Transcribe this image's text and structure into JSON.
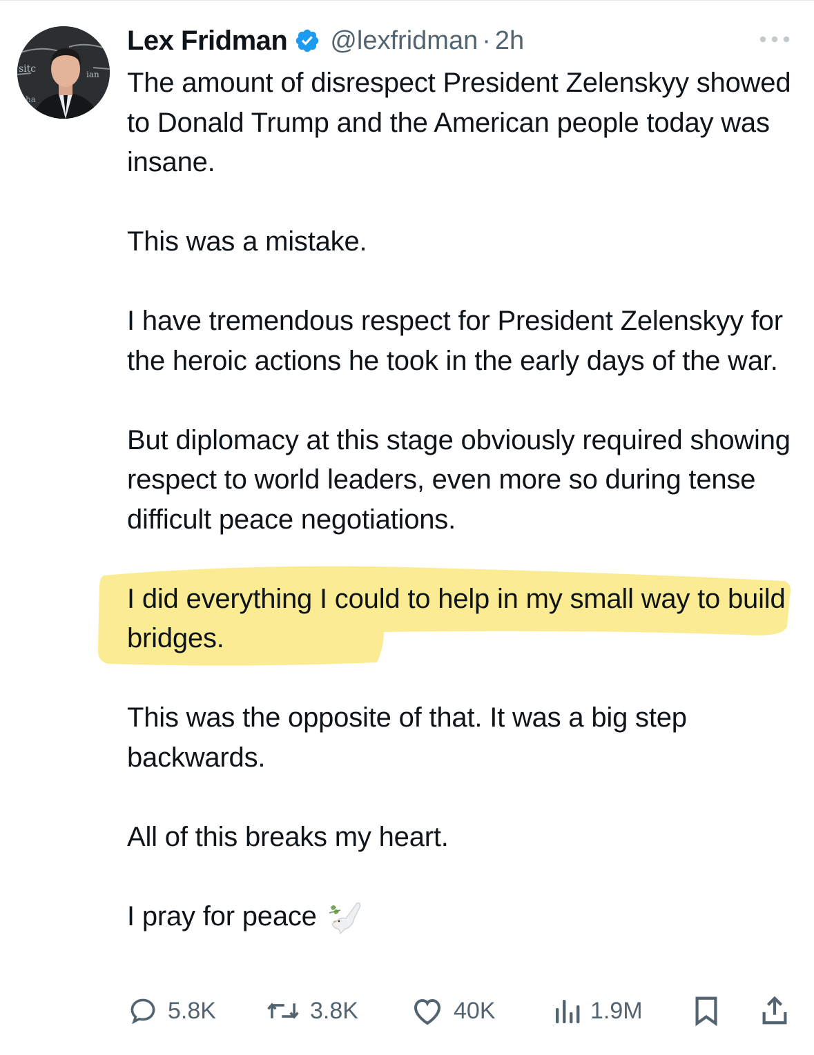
{
  "tweet": {
    "author": {
      "name": "Lex Fridman",
      "handle": "@lexfridman",
      "separator": "·",
      "time": "2h",
      "avatar_icon": "profile-photo",
      "verified_icon": "verified-badge-icon"
    },
    "paragraphs": [
      "The amount of disrespect President Zelenskyy showed to Donald Trump and the American people today was insane.",
      "This was a mistake.",
      "I have tremendous respect for President Zelenskyy for the heroic actions he took in the early days of the war.",
      "But diplomacy at this stage obviously required showing respect to world leaders, even more so during tense difficult peace negotiations.",
      "I did everything I could to help in my small way to build bridges.",
      "This was the opposite of that. It was a big step backwards.",
      "All of this breaks my heart.",
      "I pray for peace"
    ],
    "highlighted_paragraph_index": 4,
    "closing_emoji": "dove-with-olive-branch-icon",
    "stats": {
      "replies": "5.8K",
      "reposts": "3.8K",
      "likes": "40K",
      "views": "1.9M"
    }
  },
  "colors": {
    "text": "#0f1419",
    "secondary": "#536471",
    "verified": "#1d9bf0",
    "highlight": "#fbe98a"
  }
}
